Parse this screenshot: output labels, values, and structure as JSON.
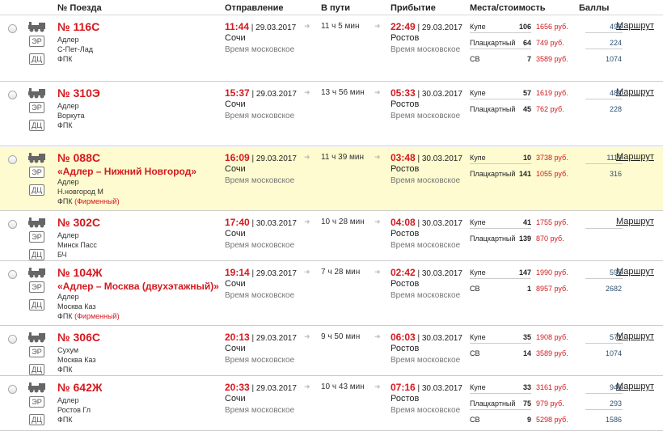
{
  "header": {
    "train_no": "№ Поезда",
    "departure": "Отправление",
    "duration": "В пути",
    "arrival": "Прибытие",
    "seats": "Места/стоимость",
    "points": "Баллы"
  },
  "labels": {
    "er_badge": "ЭР",
    "dc_badge": "ДЦ",
    "arrow": "➜",
    "route_link": "Маршрут"
  },
  "colors": {
    "accent_red": "#d4191f",
    "highlight_row": "#fdfbcf",
    "points_blue": "#2c4f70"
  },
  "trains": [
    {
      "number": "№ 116С",
      "name": "",
      "from": "Адлер",
      "to": "С-Пет-Лад",
      "carrier": "ФПК",
      "brand": "",
      "dep_time": "11:44",
      "dep_date": " | 29.03.2017",
      "dep_station": "Сочи",
      "dep_tz": "Время московское",
      "duration": "11 ч 5 мин",
      "arr_time": "22:49",
      "arr_date": " | 29.03.2017",
      "arr_station": "Ростов",
      "arr_tz": "Время московское",
      "seats": [
        {
          "type": "Купе",
          "count": "106",
          "price": "1656 руб.",
          "points": "496"
        },
        {
          "type": "Плацкартный",
          "count": "64",
          "price": "749 руб.",
          "points": "224"
        },
        {
          "type": "СВ",
          "count": "7",
          "price": "3589 руб.",
          "points": "1074"
        }
      ]
    },
    {
      "number": "№ 310Э",
      "name": "",
      "from": "Адлер",
      "to": "Воркута",
      "carrier": "ФПК",
      "brand": "",
      "dep_time": "15:37",
      "dep_date": " | 29.03.2017",
      "dep_station": "Сочи",
      "dep_tz": "Время московское",
      "duration": "13 ч 56 мин",
      "arr_time": "05:33",
      "arr_date": " | 30.03.2017",
      "arr_station": "Ростов",
      "arr_tz": "Время московское",
      "seats": [
        {
          "type": "Купе",
          "count": "57",
          "price": "1619 руб.",
          "points": "484"
        },
        {
          "type": "Плацкартный",
          "count": "45",
          "price": "762 руб.",
          "points": "228"
        }
      ]
    },
    {
      "number": "№ 088С",
      "name": "«Адлер – Нижний Новгород»",
      "from": "Адлер",
      "to": "Н.новгород М",
      "carrier": "ФПК",
      "brand": "(Фирменный)",
      "dep_time": "16:09",
      "dep_date": " | 29.03.2017",
      "dep_station": "Сочи",
      "dep_tz": "Время московское",
      "duration": "11 ч 39 мин",
      "arr_time": "03:48",
      "arr_date": " | 30.03.2017",
      "arr_station": "Ростов",
      "arr_tz": "Время московское",
      "seats": [
        {
          "type": "Купе",
          "count": "10",
          "price": "3738 руб.",
          "points": "1119"
        },
        {
          "type": "Плацкартный",
          "count": "141",
          "price": "1055 руб.",
          "points": "316"
        }
      ]
    },
    {
      "number": "№ 302С",
      "name": "",
      "from": "Адлер",
      "to": "Минск Пасс",
      "carrier": "БЧ",
      "brand": "",
      "dep_time": "17:40",
      "dep_date": " | 30.03.2017",
      "dep_station": "Сочи",
      "dep_tz": "Время московское",
      "duration": "10 ч 28 мин",
      "arr_time": "04:08",
      "arr_date": " | 30.03.2017",
      "arr_station": "Ростов",
      "arr_tz": "Время московское",
      "seats": [
        {
          "type": "Купе",
          "count": "41",
          "price": "1755 руб.",
          "points": ""
        },
        {
          "type": "Плацкартный",
          "count": "139",
          "price": "870 руб.",
          "points": ""
        }
      ]
    },
    {
      "number": "№ 104Ж",
      "name": "«Адлер – Москва (двухэтажный)»",
      "from": "Адлер",
      "to": "Москва Каз",
      "carrier": "ФПК",
      "brand": "(Фирменный)",
      "dep_time": "19:14",
      "dep_date": " | 29.03.2017",
      "dep_station": "Сочи",
      "dep_tz": "Время московское",
      "duration": "7 ч 28 мин",
      "arr_time": "02:42",
      "arr_date": " | 30.03.2017",
      "arr_station": "Ростов",
      "arr_tz": "Время московское",
      "seats": [
        {
          "type": "Купе",
          "count": "147",
          "price": "1990 руб.",
          "points": "595"
        },
        {
          "type": "СВ",
          "count": "1",
          "price": "8957 руб.",
          "points": "2682"
        }
      ]
    },
    {
      "number": "№ 306С",
      "name": "",
      "from": "Сухум",
      "to": "Москва Каз",
      "carrier": "ФПК",
      "brand": "",
      "dep_time": "20:13",
      "dep_date": " | 29.03.2017",
      "dep_station": "Сочи",
      "dep_tz": "Время московское",
      "duration": "9 ч 50 мин",
      "arr_time": "06:03",
      "arr_date": " | 30.03.2017",
      "arr_station": "Ростов",
      "arr_tz": "Время московское",
      "seats": [
        {
          "type": "Купе",
          "count": "35",
          "price": "1908 руб.",
          "points": "571"
        },
        {
          "type": "СВ",
          "count": "14",
          "price": "3589 руб.",
          "points": "1074"
        }
      ]
    },
    {
      "number": "№ 642Ж",
      "name": "",
      "from": "Адлер",
      "to": "Ростов Гл",
      "carrier": "ФПК",
      "brand": "",
      "dep_time": "20:33",
      "dep_date": " | 29.03.2017",
      "dep_station": "Сочи",
      "dep_tz": "Время московское",
      "duration": "10 ч 43 мин",
      "arr_time": "07:16",
      "arr_date": " | 30.03.2017",
      "arr_station": "Ростов",
      "arr_tz": "Время московское",
      "seats": [
        {
          "type": "Купе",
          "count": "33",
          "price": "3161 руб.",
          "points": "946"
        },
        {
          "type": "Плацкартный",
          "count": "75",
          "price": "979 руб.",
          "points": "293"
        },
        {
          "type": "СВ",
          "count": "9",
          "price": "5298 руб.",
          "points": "1586"
        }
      ]
    }
  ]
}
